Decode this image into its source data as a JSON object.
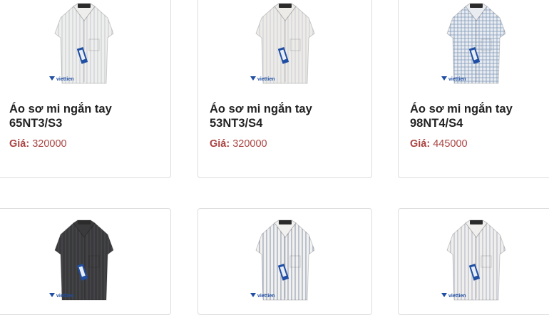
{
  "products": [
    {
      "title_line1": "Áo sơ mi ngắn tay",
      "title_line2": "65NT3/S3",
      "price_label": "Giá:",
      "price_value": "320000",
      "shirt_color": "#eeeeec",
      "stripe_color": "#b9bfc8",
      "pattern": "stripes",
      "brand": "viettien"
    },
    {
      "title_line1": "Áo sơ mi ngắn tay",
      "title_line2": "53NT3/S4",
      "price_label": "Giá:",
      "price_value": "320000",
      "shirt_color": "#ecebe8",
      "stripe_color": "#c4c7cf",
      "pattern": "stripes",
      "brand": "viettien"
    },
    {
      "title_line1": "Áo sơ mi ngắn tay",
      "title_line2": "98NT4/S4",
      "price_label": "Giá:",
      "price_value": "445000",
      "shirt_color": "#e9edf2",
      "stripe_color": "#7f97b8",
      "pattern": "check",
      "brand": "viettien"
    },
    {
      "shirt_color": "#3a3a3c",
      "stripe_color": "#55565a",
      "pattern": "stripes",
      "brand": "viettien"
    },
    {
      "shirt_color": "#f1f1ef",
      "stripe_color": "#6d7a9a",
      "pattern": "stripes",
      "brand": "viettien"
    },
    {
      "shirt_color": "#f0efed",
      "stripe_color": "#9aa1b6",
      "pattern": "stripes",
      "brand": "viettien"
    }
  ]
}
